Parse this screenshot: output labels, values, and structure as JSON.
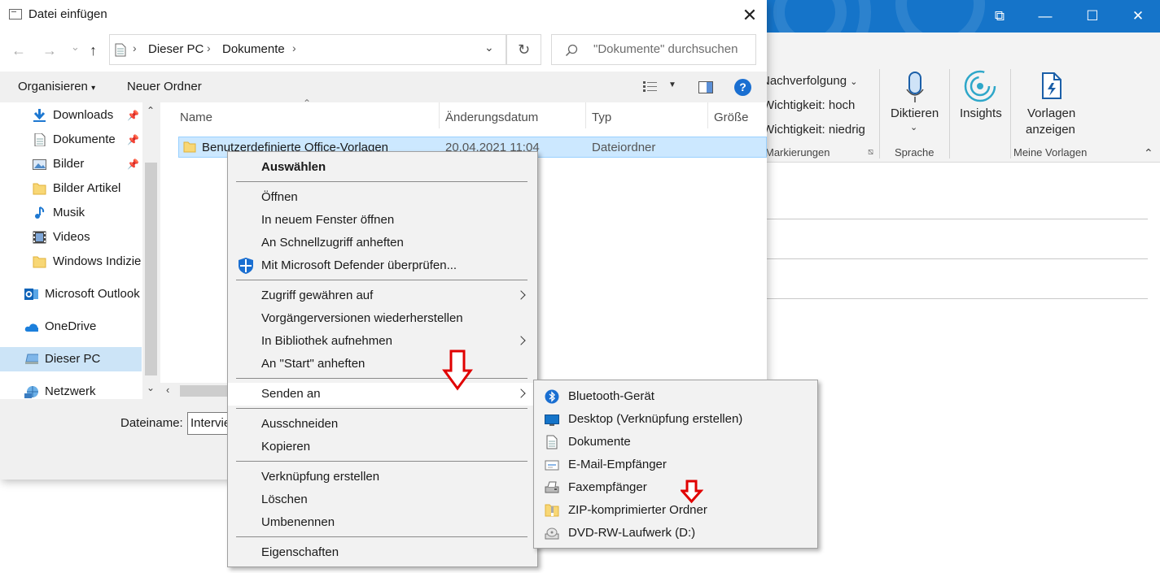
{
  "dialog": {
    "title": "Datei einfügen",
    "close_glyph": "✕",
    "nav": {
      "back_glyph": "←",
      "forward_glyph": "→",
      "dropdown_glyph": "⌄",
      "up_glyph": "↑"
    },
    "breadcrumb": [
      "Dieser PC",
      "Dokumente"
    ],
    "refresh_glyph": "↻",
    "search_placeholder": "\"Dokumente\" durchsuchen",
    "toolbar": {
      "organize": "Organisieren",
      "new_folder": "Neuer Ordner",
      "help": "?"
    },
    "nav_pane": [
      {
        "label": "Downloads",
        "icon": "download-icon",
        "pinned": true
      },
      {
        "label": "Dokumente",
        "icon": "documents-icon",
        "pinned": true
      },
      {
        "label": "Bilder",
        "icon": "pictures-icon",
        "pinned": true
      },
      {
        "label": "Bilder Artikel",
        "icon": "folder-icon",
        "pinned": false
      },
      {
        "label": "Musik",
        "icon": "music-icon",
        "pinned": false
      },
      {
        "label": "Videos",
        "icon": "videos-icon",
        "pinned": false
      },
      {
        "label": "Windows Indizie",
        "icon": "folder-icon",
        "pinned": false
      },
      {
        "label": "Microsoft Outlook",
        "icon": "outlook-icon",
        "pinned": false
      },
      {
        "label": "OneDrive",
        "icon": "onedrive-icon",
        "pinned": false
      },
      {
        "label": "Dieser PC",
        "icon": "this-pc-icon",
        "pinned": false
      },
      {
        "label": "Netzwerk",
        "icon": "network-icon",
        "pinned": false
      }
    ],
    "pin_glyph": "📌",
    "columns": [
      "Name",
      "Änderungsdatum",
      "Typ",
      "Größe"
    ],
    "rows": [
      {
        "name": "Benutzerdefinierte Office-Vorlagen",
        "date": "20.04.2021 11:04",
        "type": "Dateiordner",
        "size": ""
      }
    ],
    "filename_label": "Dateiname:",
    "filename_value": "Intervie"
  },
  "context_menu": {
    "items": [
      {
        "label": "Auswählen",
        "bold": true
      },
      {
        "sep": true
      },
      {
        "label": "Öffnen"
      },
      {
        "label": "In neuem Fenster öffnen"
      },
      {
        "label": "An Schnellzugriff anheften"
      },
      {
        "label": "Mit Microsoft Defender überprüfen...",
        "icon": "defender-shield-icon"
      },
      {
        "sep": true
      },
      {
        "label": "Zugriff gewähren auf",
        "submenu": true
      },
      {
        "label": "Vorgängerversionen wiederherstellen"
      },
      {
        "label": "In Bibliothek aufnehmen",
        "submenu": true
      },
      {
        "label": "An \"Start\" anheften"
      },
      {
        "sep": true
      },
      {
        "label": "Senden an",
        "submenu": true,
        "selected": true
      },
      {
        "sep": true
      },
      {
        "label": "Ausschneiden"
      },
      {
        "label": "Kopieren"
      },
      {
        "sep": true
      },
      {
        "label": "Verknüpfung erstellen"
      },
      {
        "label": "Löschen"
      },
      {
        "label": "Umbenennen"
      },
      {
        "sep": true
      },
      {
        "label": "Eigenschaften"
      }
    ]
  },
  "send_to_menu": {
    "items": [
      {
        "label": "Bluetooth-Gerät",
        "icon": "bluetooth-icon"
      },
      {
        "label": "Desktop (Verknüpfung erstellen)",
        "icon": "desktop-icon"
      },
      {
        "label": "Dokumente",
        "icon": "documents-icon"
      },
      {
        "label": "E-Mail-Empfänger",
        "icon": "mail-recipient-icon"
      },
      {
        "label": "Faxempfänger",
        "icon": "fax-icon"
      },
      {
        "label": "ZIP-komprimierter Ordner",
        "icon": "zip-folder-icon"
      },
      {
        "label": "DVD-RW-Laufwerk (D:)",
        "icon": "dvd-drive-icon"
      }
    ]
  },
  "outlook": {
    "window_buttons": [
      "⧉",
      "—",
      "☐",
      "✕"
    ],
    "ribbon": {
      "tracking": "Nachverfolgung",
      "importance_high": "Wichtigkeit: hoch",
      "importance_low": "Wichtigkeit: niedrig",
      "group_tags": "Markierungen",
      "dictate": "Diktieren",
      "group_voice": "Sprache",
      "insights": "Insights",
      "templates_line1": "Vorlagen",
      "templates_line2": "anzeigen",
      "group_my_templates": "Meine Vorlagen"
    }
  },
  "colors": {
    "outlook_blue": "#1574c9",
    "selection": "#cce8ff",
    "annotation_red": "#e00000",
    "help_blue": "#1a6fd1"
  }
}
